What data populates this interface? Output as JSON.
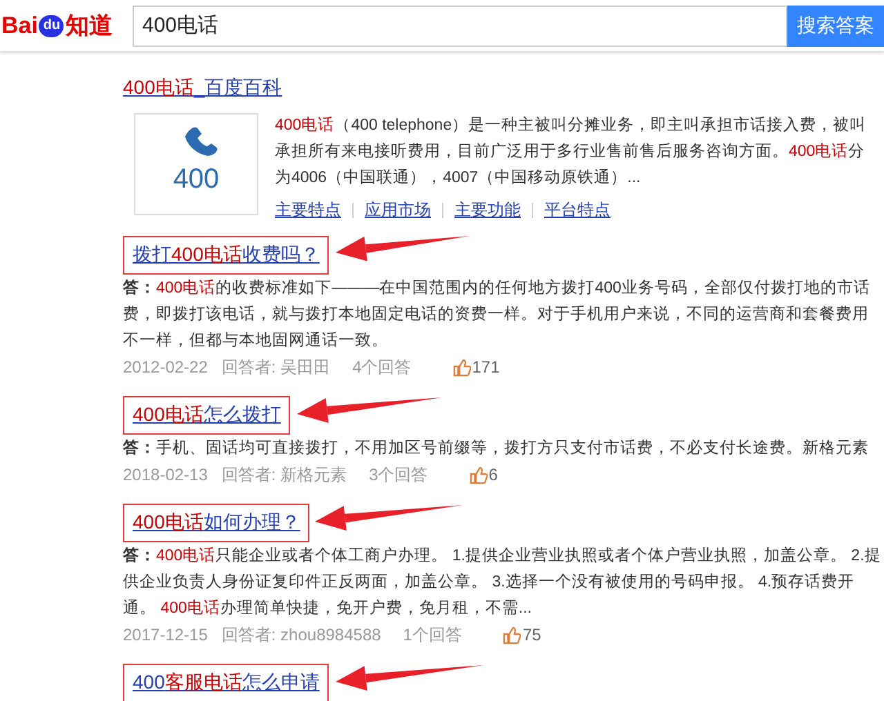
{
  "header": {
    "logo": {
      "bai": "Bai",
      "du": "du",
      "zhidao": "知道"
    },
    "search": {
      "value": "400电话"
    },
    "button": "搜索答案"
  },
  "baike": {
    "title": [
      {
        "text": "400电话",
        "hl": true
      },
      {
        "text": "_百度百科",
        "hl": false
      }
    ],
    "image_text": "400",
    "summary": [
      {
        "text": "400电话",
        "hl": true
      },
      {
        "text": "（400 telephone）是一种主被叫分摊业务，即主叫承担市话接入费，被叫承担所有来电接听费用，目前广泛用于多行业售前售后服务咨询方面。",
        "hl": false
      },
      {
        "text": "400电话",
        "hl": true
      },
      {
        "text": "分为4006（中国联通），4007（中国移动原铁通）...",
        "hl": false
      }
    ],
    "links": [
      "主要特点",
      "应用市场",
      "主要功能",
      "平台特点"
    ]
  },
  "results": [
    {
      "title": [
        {
          "text": "拨打",
          "hl": false
        },
        {
          "text": "400电话",
          "hl": true
        },
        {
          "text": "收费吗？",
          "hl": false
        }
      ],
      "answer_label": "答：",
      "answer": [
        {
          "text": "400电话",
          "hl": true
        },
        {
          "text": "的收费标准如下———在中国范围内的任何地方拨打400业务号码，全部仅付拨打地的市话费，即拨打该电话，就与拨打本地固定电话的资费一样。对于手机用户来说，不同的运营商和套餐费用不一样，但都与本地固网通话一致。",
          "hl": false
        }
      ],
      "date": "2012-02-22",
      "answerer": "回答者: 吴田田",
      "count": "4个回答",
      "likes": "171"
    },
    {
      "title": [
        {
          "text": "400电话",
          "hl": true
        },
        {
          "text": "怎么拨打",
          "hl": false
        }
      ],
      "answer_label": "答：",
      "answer": [
        {
          "text": "手机、固话均可直接拨打，不用加区号前缀等，拨打方只支付市话费，不必支付长途费。新格元素",
          "hl": false
        }
      ],
      "date": "2018-02-13",
      "answerer": "回答者: 新格元素",
      "count": "3个回答",
      "likes": "6"
    },
    {
      "title": [
        {
          "text": "400电话",
          "hl": true
        },
        {
          "text": "如何办理？",
          "hl": false
        }
      ],
      "answer_label": "答：",
      "answer": [
        {
          "text": "400电话",
          "hl": true
        },
        {
          "text": "只能企业或者个体工商户办理。 1.提供企业营业执照或者个体户营业执照，加盖公章。 2.提供企业负责人身份证复印件正反两面，加盖公章。 3.选择一个没有被使用的号码申报。 4.预存话费开通。 ",
          "hl": false
        },
        {
          "text": "400电话",
          "hl": true
        },
        {
          "text": "办理简单快捷，免开户费，免月租，不需...",
          "hl": false
        }
      ],
      "date": "2017-12-15",
      "answerer": "回答者: zhou8984588",
      "count": "1个回答",
      "likes": "75"
    },
    {
      "title": [
        {
          "text": "400",
          "hl": false
        },
        {
          "text": "客服电话",
          "hl": true
        },
        {
          "text": "怎么申请",
          "hl": false
        }
      ]
    }
  ]
}
